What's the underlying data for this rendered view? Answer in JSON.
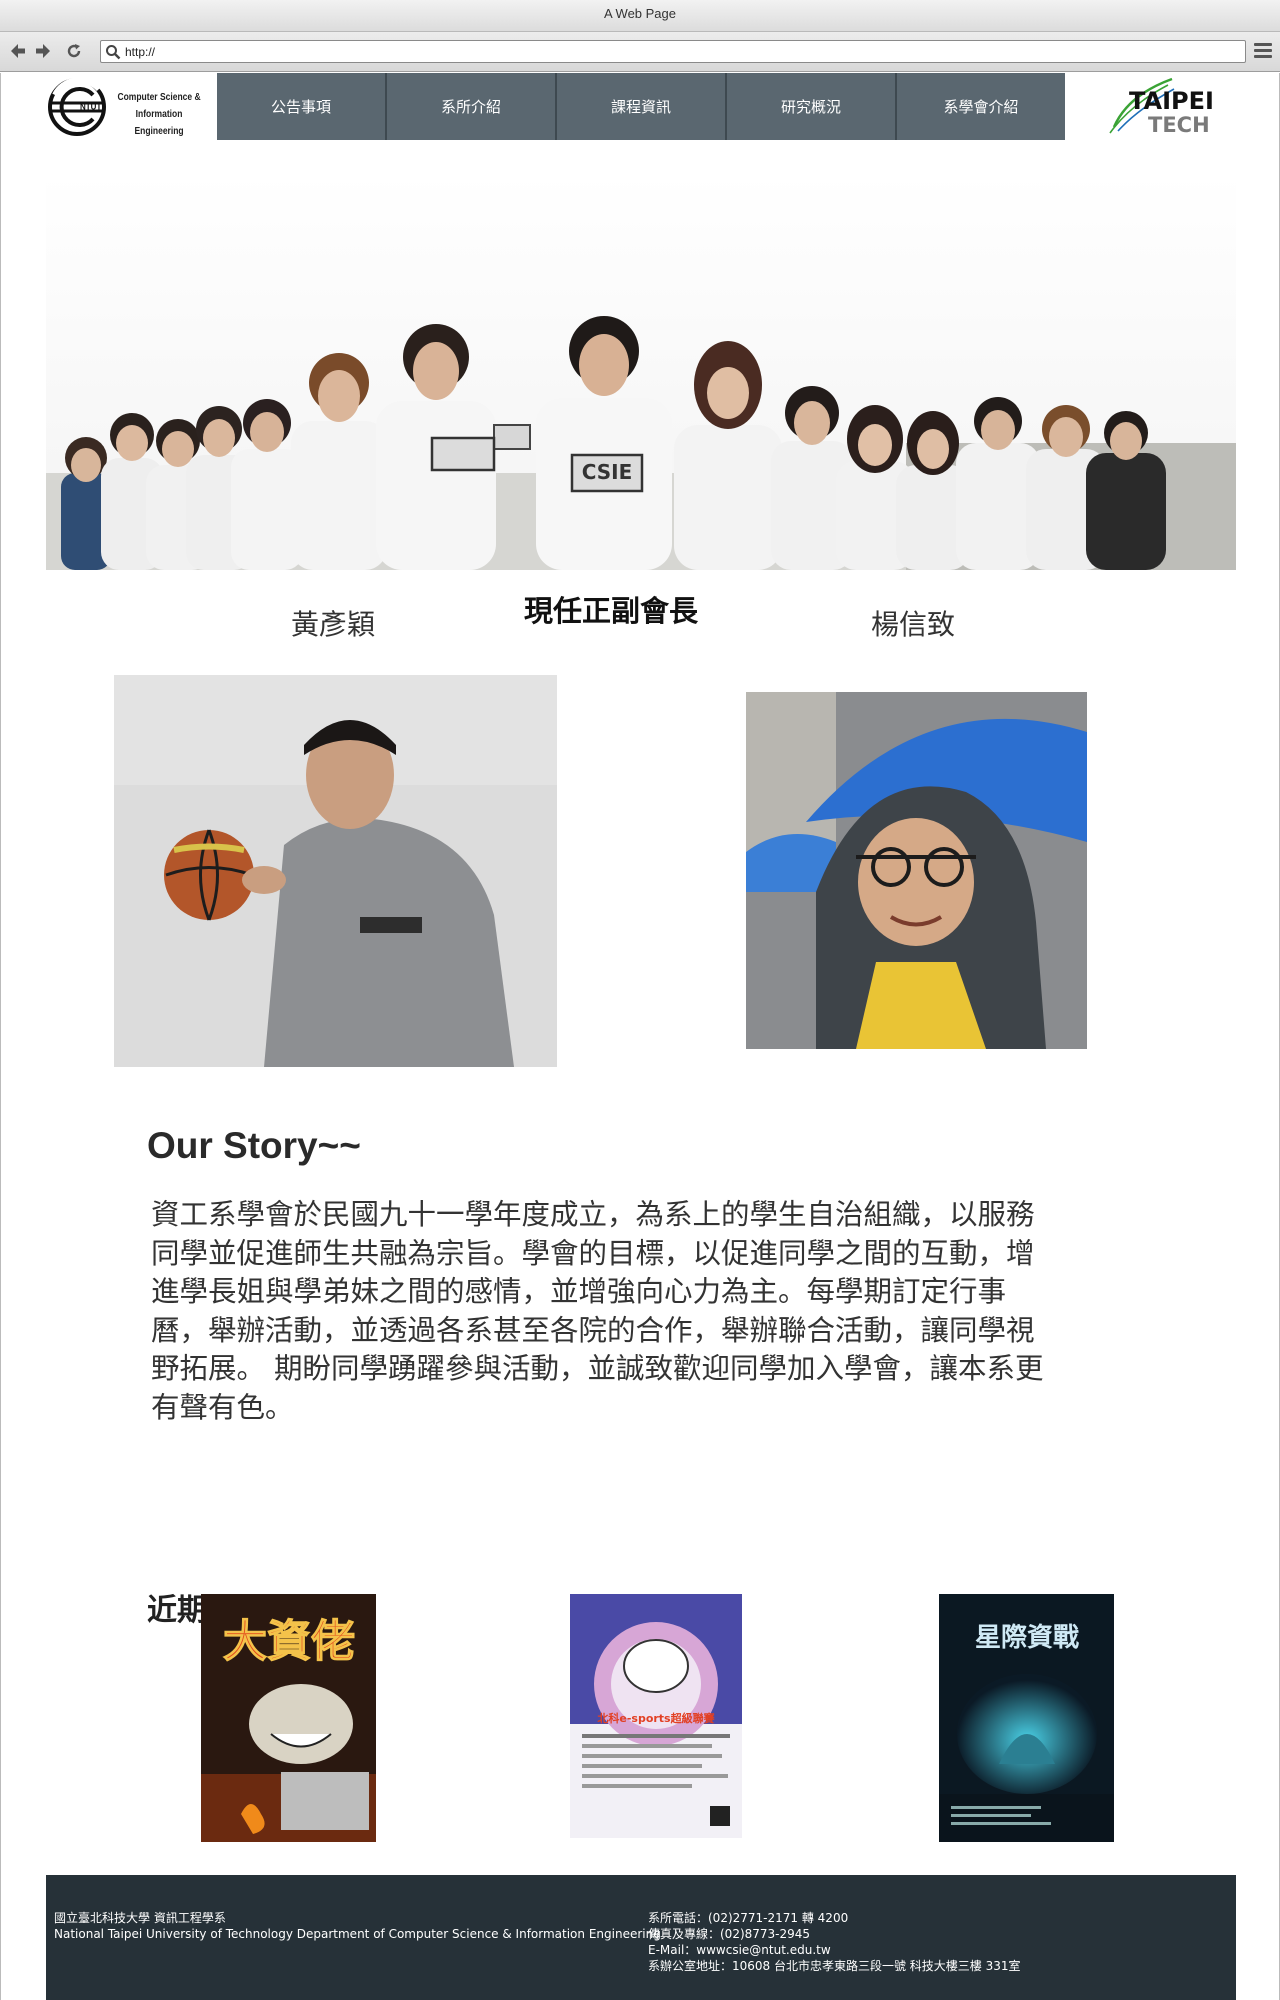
{
  "window": {
    "title": "A Web Page"
  },
  "browser": {
    "url": "http://"
  },
  "header": {
    "logo_left_lines": [
      "Computer Science &",
      "Information Engineering"
    ],
    "logo_left_mark": "NTUT",
    "nav": [
      "公告事項",
      "系所介紹",
      "課程資訊",
      "研究概況",
      "系學會介紹"
    ],
    "logo_right_line1": "TAIPEI",
    "logo_right_line2": "TECH"
  },
  "hero": {
    "shirt_text": "CSIE"
  },
  "officers": {
    "title": "現任正副會長",
    "left_name": "黃彥穎",
    "right_name": "楊信致"
  },
  "story": {
    "title": "Our Story~~",
    "lines": [
      "資工系學會於民國九十一學年度成立，為系上的學生自治組織，以服務",
      "同學並促進師生共融為宗旨。學會的目標，以促進同學之間的互動，增",
      "進學長姐與學弟妹之間的感情，並增強向心力為主。每學期訂定行事",
      "曆，舉辦活動，並透過各系甚至各院的合作，舉辦聯合活動，讓同學視",
      "野拓展。 期盼同學踴躍參與活動，並誠致歡迎同學加入學會，讓本系更",
      "有聲有色。"
    ]
  },
  "events": {
    "title": "近期活動>>>>",
    "posters": [
      {
        "headline": "大資佬"
      },
      {
        "headline": "北科e-sports超級聯賽"
      },
      {
        "headline": "星際資戰"
      }
    ]
  },
  "footer": {
    "left_lines": [
      "國立臺北科技大學 資訊工程學系",
      "National Taipei University of Technology Department of Computer Science & Information Engineering"
    ],
    "right_lines": [
      "系所電話：(02)2771-2171 轉 4200",
      "傳真及專線：(02)8773-2945",
      "E-Mail：wwwcsie@ntut.edu.tw",
      "系辦公室地址：10608 台北市忠孝東路三段一號 科技大樓三樓 331室"
    ]
  },
  "colors": {
    "nav_bg": "#5a6770",
    "footer_bg": "#263138",
    "brand_green": "#3aa335"
  }
}
